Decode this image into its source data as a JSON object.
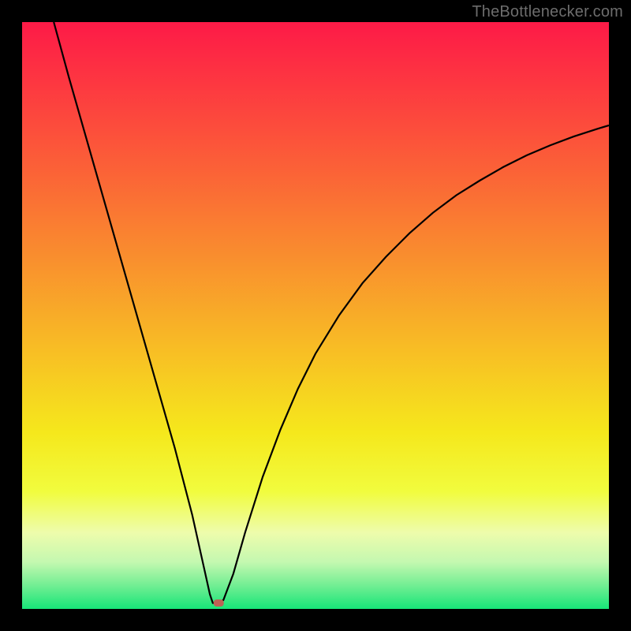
{
  "watermark": "TheBottlenecker.com",
  "chart_data": {
    "type": "line",
    "title": "",
    "xlabel": "",
    "ylabel": "",
    "xlim": [
      0,
      1
    ],
    "ylim": [
      0,
      1
    ],
    "x_min_at": 0.325,
    "series": [
      {
        "name": "bottleneck-curve",
        "color": "#000000",
        "points": [
          {
            "x": 0.054,
            "y": 1.0
          },
          {
            "x": 0.08,
            "y": 0.905
          },
          {
            "x": 0.11,
            "y": 0.8
          },
          {
            "x": 0.14,
            "y": 0.695
          },
          {
            "x": 0.17,
            "y": 0.59
          },
          {
            "x": 0.2,
            "y": 0.485
          },
          {
            "x": 0.23,
            "y": 0.38
          },
          {
            "x": 0.26,
            "y": 0.275
          },
          {
            "x": 0.29,
            "y": 0.16
          },
          {
            "x": 0.31,
            "y": 0.07
          },
          {
            "x": 0.32,
            "y": 0.025
          },
          {
            "x": 0.325,
            "y": 0.01
          },
          {
            "x": 0.335,
            "y": 0.01
          },
          {
            "x": 0.343,
            "y": 0.015
          },
          {
            "x": 0.36,
            "y": 0.06
          },
          {
            "x": 0.38,
            "y": 0.13
          },
          {
            "x": 0.41,
            "y": 0.225
          },
          {
            "x": 0.44,
            "y": 0.305
          },
          {
            "x": 0.47,
            "y": 0.375
          },
          {
            "x": 0.5,
            "y": 0.435
          },
          {
            "x": 0.54,
            "y": 0.5
          },
          {
            "x": 0.58,
            "y": 0.555
          },
          {
            "x": 0.62,
            "y": 0.6
          },
          {
            "x": 0.66,
            "y": 0.64
          },
          {
            "x": 0.7,
            "y": 0.675
          },
          {
            "x": 0.74,
            "y": 0.705
          },
          {
            "x": 0.78,
            "y": 0.73
          },
          {
            "x": 0.82,
            "y": 0.753
          },
          {
            "x": 0.86,
            "y": 0.773
          },
          {
            "x": 0.9,
            "y": 0.79
          },
          {
            "x": 0.94,
            "y": 0.805
          },
          {
            "x": 0.98,
            "y": 0.818
          },
          {
            "x": 1.0,
            "y": 0.824
          }
        ]
      }
    ],
    "marker": {
      "name": "optimal-point",
      "x": 0.335,
      "y": 0.01,
      "color": "#be6155"
    },
    "gradient_stops": [
      {
        "offset": 0.0,
        "color": "#fd1a47"
      },
      {
        "offset": 0.1,
        "color": "#fd3641"
      },
      {
        "offset": 0.25,
        "color": "#fb6137"
      },
      {
        "offset": 0.4,
        "color": "#f98e2e"
      },
      {
        "offset": 0.55,
        "color": "#f8bb25"
      },
      {
        "offset": 0.7,
        "color": "#f5e81c"
      },
      {
        "offset": 0.8,
        "color": "#f1fc3e"
      },
      {
        "offset": 0.87,
        "color": "#eefcac"
      },
      {
        "offset": 0.92,
        "color": "#c4f8b0"
      },
      {
        "offset": 0.96,
        "color": "#72ee93"
      },
      {
        "offset": 1.0,
        "color": "#17e578"
      }
    ]
  }
}
